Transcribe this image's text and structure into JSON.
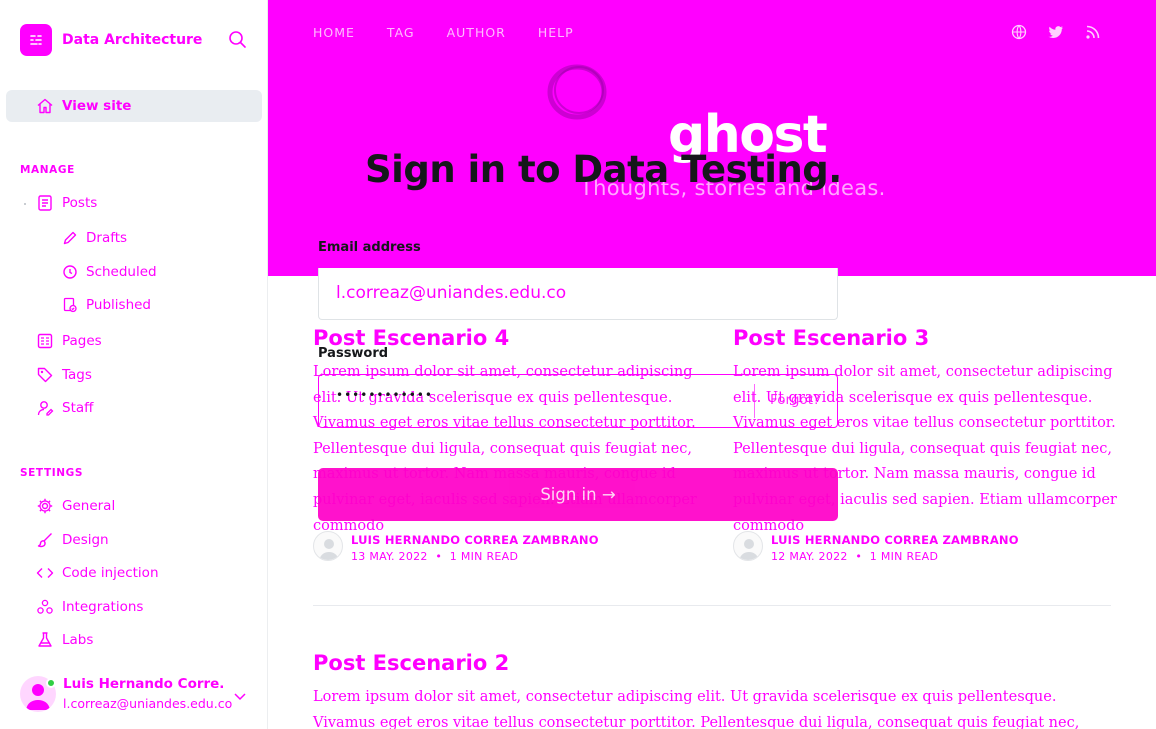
{
  "sidebar": {
    "brand": "Data Architecture",
    "view_site": "View site",
    "manage_title": "MANAGE",
    "items": {
      "posts": "Posts",
      "drafts": "Drafts",
      "scheduled": "Scheduled",
      "published": "Published",
      "pages": "Pages",
      "tags": "Tags",
      "staff": "Staff"
    },
    "settings_title": "SETTINGS",
    "settings": {
      "general": "General",
      "design": "Design",
      "code_injection": "Code injection",
      "integrations": "Integrations",
      "labs": "Labs"
    },
    "user": {
      "name": "Luis Hernando Corre...",
      "email": "l.correaz@uniandes.edu.co"
    }
  },
  "site": {
    "nav": [
      "HOME",
      "TAG",
      "AUTHOR",
      "HELP"
    ],
    "social_icons": [
      "globe-icon",
      "twitter-icon",
      "rss-icon"
    ],
    "logo": "ghost",
    "tagline": "Thoughts, stories and ideas.",
    "posts": [
      {
        "title": "Post Escenario 4",
        "excerpt": "Lorem ipsum dolor sit amet, consectetur adipiscing elit. Ut gravida scelerisque ex quis pellentesque. Vivamus eget eros vitae tellus consectetur porttitor. Pellentesque dui ligula, consequat quis feugiat nec, maximus ut tortor. Nam massa mauris, congue id pulvinar eget, iaculis sed sapien. Etiam ullamcorper commodo",
        "author": "LUIS HERNANDO CORREA ZAMBRANO",
        "date": "13 MAY. 2022",
        "read": "1 MIN READ"
      },
      {
        "title": "Post Escenario 3",
        "excerpt": "Lorem ipsum dolor sit amet, consectetur adipiscing elit. Ut gravida scelerisque ex quis pellentesque. Vivamus eget eros vitae tellus consectetur porttitor. Pellentesque dui ligula, consequat quis feugiat nec, maximus ut tortor. Nam massa mauris, congue id pulvinar eget, iaculis sed sapien. Etiam ullamcorper commodo",
        "author": "LUIS HERNANDO CORREA ZAMBRANO",
        "date": "12 MAY. 2022",
        "read": "1 MIN READ"
      },
      {
        "title": "Post Escenario 2",
        "excerpt": "Lorem ipsum dolor sit amet, consectetur adipiscing elit. Ut gravida scelerisque ex quis pellentesque. Vivamus eget eros vitae tellus consectetur porttitor. Pellentesque dui ligula, consequat quis feugiat nec, maximus ut tortor. Nam massa mauris,"
      }
    ]
  },
  "signin": {
    "title": "Sign in to Data Testing.",
    "email_label": "Email address",
    "email_value": "l.correaz@uniandes.edu.co",
    "password_label": "Password",
    "password_dots": "••••••••••••",
    "forgot": "Forgot?",
    "button": "Sign in →"
  },
  "colors": {
    "accent": "#ff00ff",
    "button": "#ff00c8",
    "title_text": "#15171a"
  }
}
